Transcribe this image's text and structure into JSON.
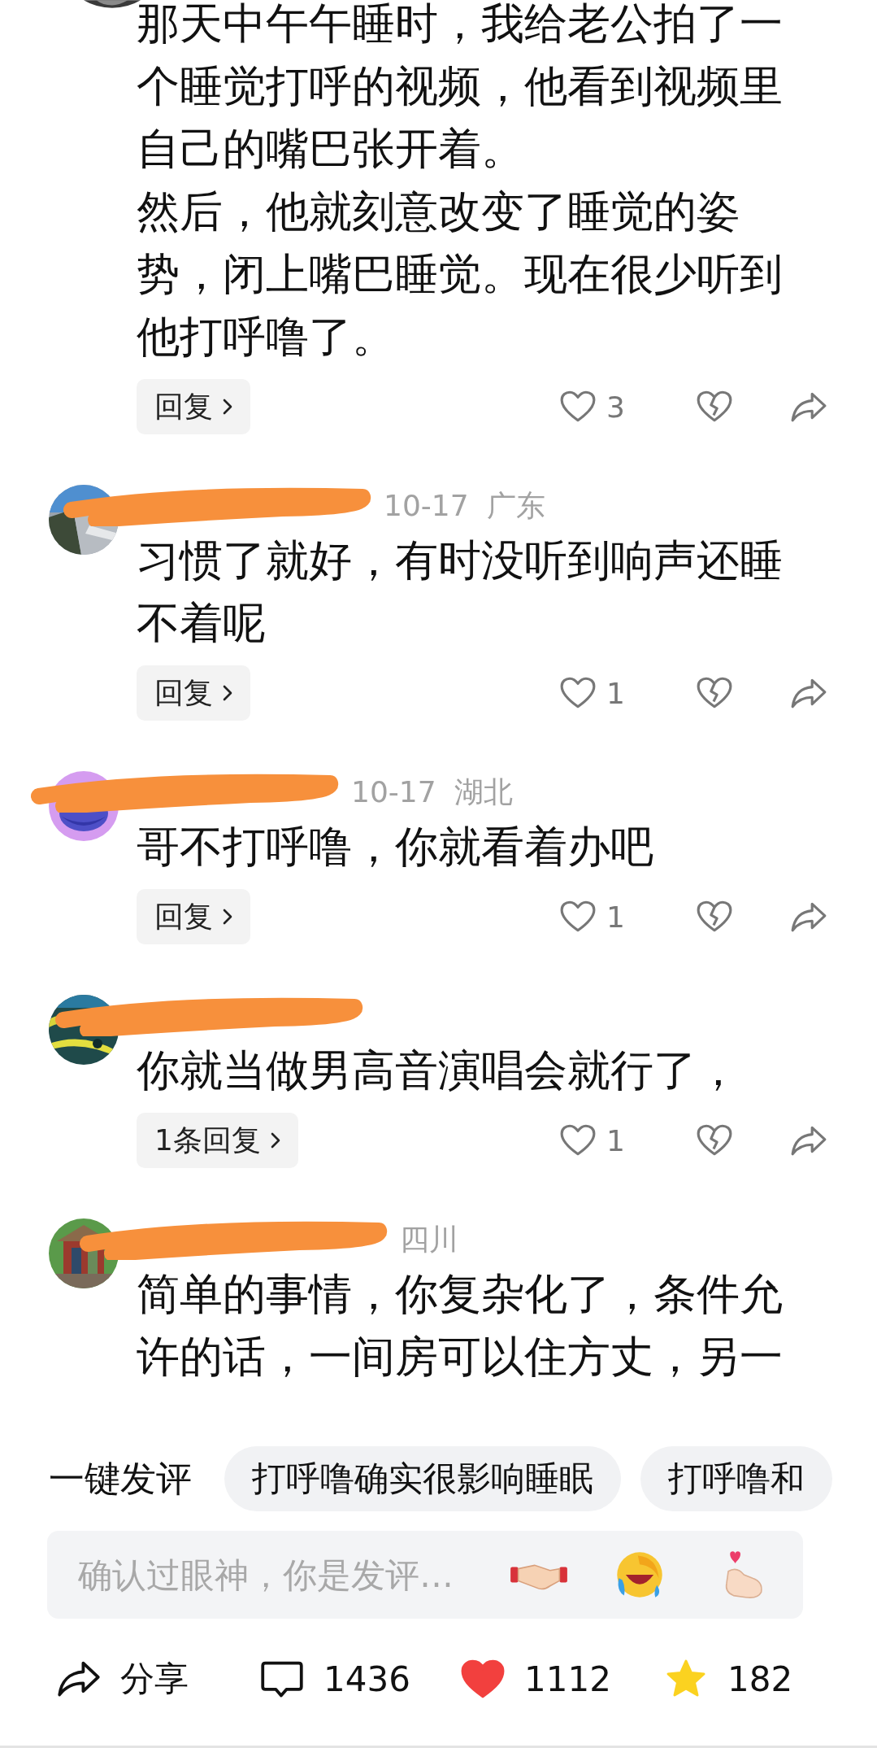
{
  "comments": [
    {
      "text": [
        "那天中午午睡时，我给老公拍了一个睡觉打呼的视频，他看到视频里自己的嘴巴张开着。",
        "然后，他就刻意改变了睡觉的姿势，闭上嘴巴睡觉。现在很少听到他打呼噜了。"
      ],
      "reply": "回复",
      "likes": "3"
    },
    {
      "meta": "10-17  广东",
      "text": [
        "习惯了就好，有时没听到响声还睡不着呢"
      ],
      "reply": "回复",
      "likes": "1"
    },
    {
      "meta": "10-17  湖北",
      "text": [
        "哥不打呼噜，你就看着办吧"
      ],
      "reply": "回复",
      "likes": "1"
    },
    {
      "text": [
        "你就当做男高音演唱会就行了，"
      ],
      "reply": "1条回复",
      "likes": "1"
    },
    {
      "meta": "四川",
      "text": [
        "简单的事情，你复杂化了，条件允许的话，一间房可以住方丈，另一"
      ]
    }
  ],
  "quick_comments": {
    "label": "一键发评",
    "chips": [
      "打呼噜确实很影响睡眠",
      "打呼噜和"
    ]
  },
  "comment_input": {
    "placeholder": "确认过眼神，你是发评…"
  },
  "bottom_bar": [
    {
      "kind": "share",
      "label": "分享"
    },
    {
      "kind": "comment",
      "label": "1436"
    },
    {
      "kind": "like",
      "label": "1112",
      "on": true
    },
    {
      "kind": "favorite",
      "label": "182",
      "on": true
    }
  ]
}
